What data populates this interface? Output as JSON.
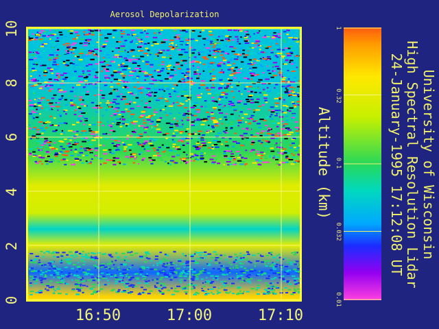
{
  "chart_data": {
    "type": "heatmap",
    "title": "Aerosol Depolarization",
    "ylabel": "Altitude (km)",
    "xlabel": "",
    "x_ticks": [
      "16:50",
      "17:00",
      "17:10"
    ],
    "y_ticks": [
      "0",
      "2",
      "4",
      "6",
      "8",
      "10"
    ],
    "ylim": [
      0,
      10
    ],
    "grid": true,
    "colorbar": {
      "ticks": [
        "1",
        "0.32",
        "0.1",
        "0.032",
        "0.01"
      ],
      "scale": "log",
      "range": [
        0.01,
        1
      ]
    },
    "profile": [
      {
        "altitude_km": 0.1,
        "depolarization": 0.5
      },
      {
        "altitude_km": 1.0,
        "depolarization": 0.03
      },
      {
        "altitude_km": 2.0,
        "depolarization": 0.32
      },
      {
        "altitude_km": 2.6,
        "depolarization": 0.06
      },
      {
        "altitude_km": 3.2,
        "depolarization": 0.25
      },
      {
        "altitude_km": 4.2,
        "depolarization": 0.3
      },
      {
        "altitude_km": 5.5,
        "depolarization": 0.1
      },
      {
        "altitude_km": 8.0,
        "depolarization": 0.05
      }
    ]
  },
  "side_text": {
    "line1": "University of Wisconsin",
    "line2": "High Spectral Resolution Lidar",
    "line3": "24-January-1995 17:12:08 UT"
  },
  "colors": {
    "background": "#1f2480",
    "frame": "#ffff33",
    "text": "#f5f57a"
  }
}
